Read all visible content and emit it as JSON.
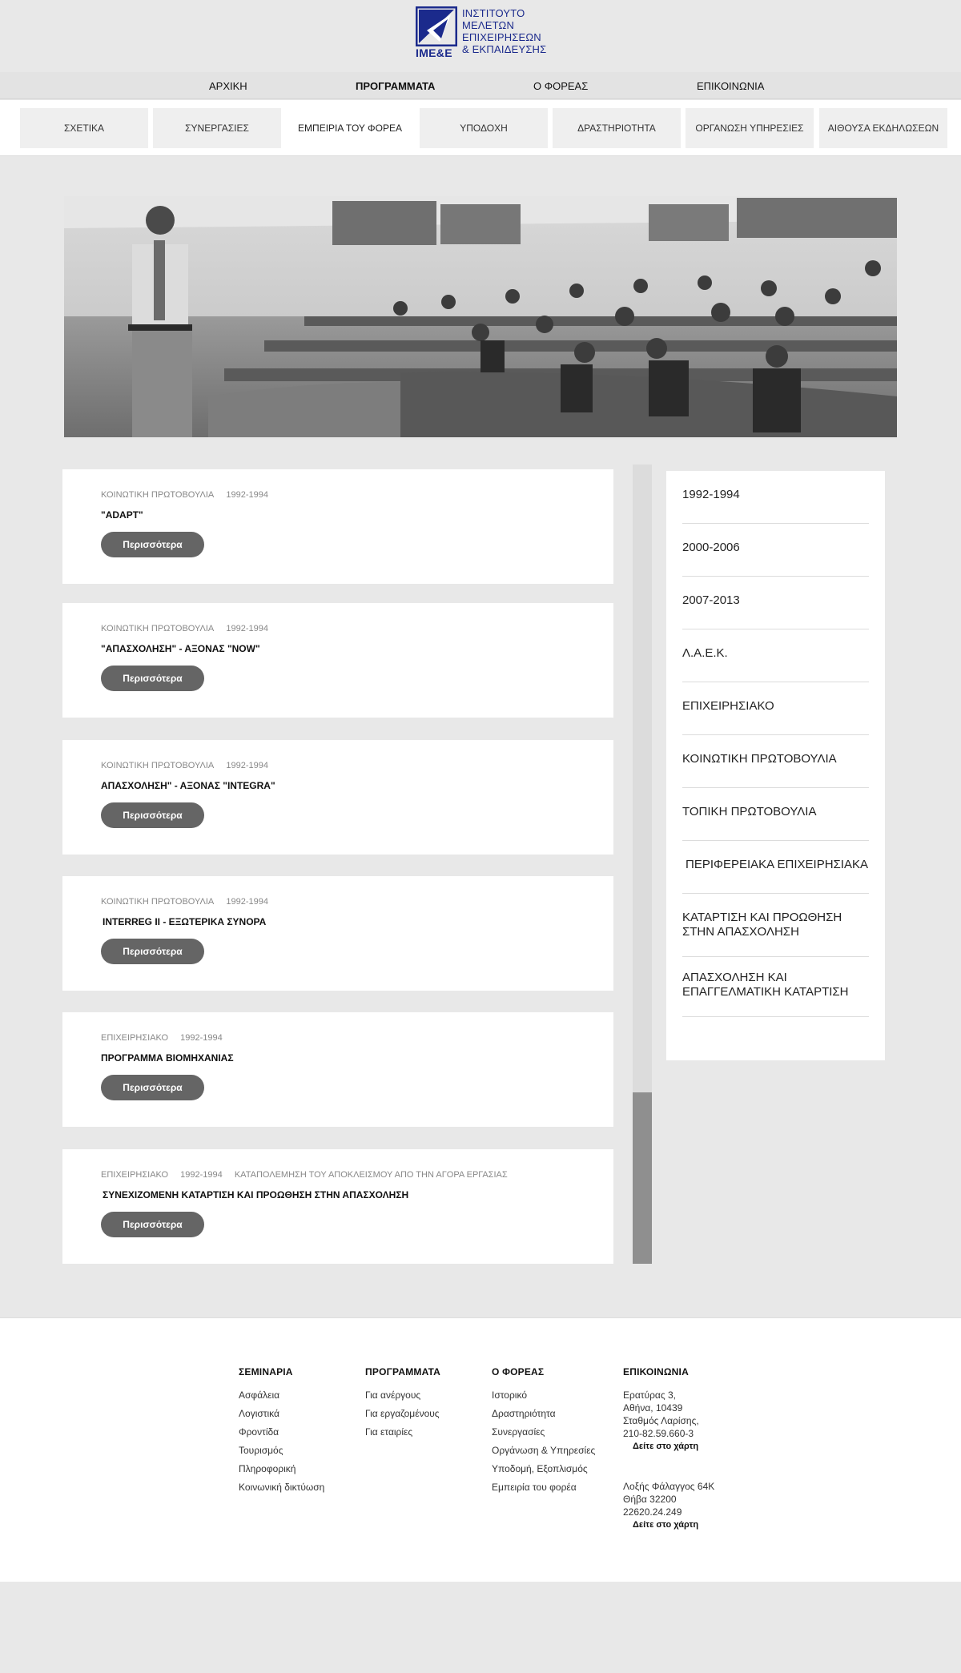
{
  "brand": {
    "lines": [
      "ΙΝΣΤΙΤΟΥΤΟ",
      "ΜΕΛΕΤΩΝ",
      "ΕΠΙΧΕΙΡΗΣΕΩΝ",
      "& ΕΚΠΑΙΔΕΥΣΗΣ"
    ],
    "abbr": "IME&E",
    "color": "#1b2a8c"
  },
  "main_nav": [
    "ΑΡΧΙΚΗ",
    "ΠΡΟΓΡΑΜΜΑΤΑ",
    "Ο ΦΟΡΕΑΣ",
    "ΕΠΙΚΟΙΝΩΝΙΑ"
  ],
  "main_nav_active": "ΠΡΟΓΡΑΜΜΑΤΑ",
  "sub_nav": [
    "ΣΧΕΤΙΚΑ",
    "ΣΥΝΕΡΓΑΣΙΕΣ",
    "ΕΜΠΕΙΡΙΑ ΤΟΥ ΦΟΡΕΑ",
    "ΥΠΟΔΟΧΗ",
    "ΔΡΑΣΤΗΡΙΟΤΗΤΑ",
    "ΟΡΓΑΝΩΣΗ ΥΠΗΡΕΣΙΕΣ",
    "ΑΙΘΟΥΣΑ ΕΚΔΗΛΩΣΕΩΝ"
  ],
  "sub_nav_active": "ΕΜΠΕΙΡΙΑ ΤΟΥ ΦΟΡΕΑ",
  "programs": [
    {
      "meta": [
        "ΚΟΙΝΩΤΙΚΗ ΠΡΩΤΟΒΟΥΛΙΑ",
        "1992-1994"
      ],
      "title": "\"ADAPT\"",
      "button": "Περισσότερα"
    },
    {
      "meta": [
        "ΚΟΙΝΩΤΙΚΗ ΠΡΩΤΟΒΟΥΛΙΑ",
        "1992-1994"
      ],
      "title": "\"ΑΠΑΣΧΟΛΗΣΗ\" - ΑΞΟΝΑΣ \"NOW\"",
      "button": "Περισσότερα"
    },
    {
      "meta": [
        "ΚΟΙΝΩΤΙΚΗ ΠΡΩΤΟΒΟΥΛΙΑ",
        "1992-1994"
      ],
      "title": "ΑΠΑΣΧΟΛΗΣΗ\" - ΑΞΟΝΑΣ \"INTEGRA\"",
      "button": "Περισσότερα"
    },
    {
      "meta": [
        "ΚΟΙΝΩΤΙΚΗ ΠΡΩΤΟΒΟΥΛΙΑ",
        "1992-1994"
      ],
      "title": "INTERREG II - ΕΞΩΤΕΡΙΚΑ ΣΥΝΟΡΑ",
      "button": "Περισσότερα"
    },
    {
      "meta": [
        "ΕΠΙΧΕΙΡΗΣΙΑΚΟ",
        "1992-1994"
      ],
      "title": "ΠΡΟΓΡΑΜΜΑ ΒΙΟΜΗΧΑΝΙΑΣ",
      "button": "Περισσότερα"
    },
    {
      "meta": [
        "ΕΠΙΧΕΙΡΗΣΙΑΚΟ",
        "1992-1994",
        "ΚΑΤΑΠΟΛΕΜΗΣΗ ΤΟΥ ΑΠΟΚΛΕΙΣΜΟΥ ΑΠΟ ΤΗΝ ΑΓΟΡΑ ΕΡΓΑΣΙΑΣ"
      ],
      "title": "ΣΥΝΕΧΙΖΟΜΕΝΗ ΚΑΤΑΡΤΙΣΗ ΚΑΙ ΠΡΟΩΘΗΣΗ ΣΤΗΝ ΑΠΑΣΧΟΛΗΣΗ",
      "button": "Περισσότερα"
    }
  ],
  "scroll": {
    "position": 0.79
  },
  "filters": [
    "1992-1994",
    "2000-2006",
    "2007-2013",
    "Λ.Α.Ε.Κ.",
    "ΕΠΙΧΕΙΡΗΣΙΑΚΟ",
    "ΚΟΙΝΩΤΙΚΗ ΠΡΩΤΟΒΟΥΛΙΑ",
    "ΤΟΠΙΚΗ ΠΡΩΤΟΒΟΥΛΙΑ",
    " ΠΕΡΙΦΕΡΕΙΑΚΑ ΕΠΙΧΕΙΡΗΣΙΑΚΑ",
    "ΚΑΤΑΡΤΙΣΗ ΚΑΙ ΠΡΟΩΘΗΣΗ ΣΤΗΝ ΑΠΑΣΧΟΛΗΣΗ",
    "ΑΠΑΣΧΟΛΗΣΗ ΚΑΙ ΕΠΑΓΓΕΛΜΑΤΙΚΗ ΚΑΤΑΡΤΙΣΗ"
  ],
  "footer": {
    "seminars": {
      "heading": "ΣΕΜΙΝΑΡΙΑ",
      "links": [
        "Ασφάλεια",
        "Λογιστικά",
        "Φροντίδα",
        "Τουρισμός",
        "Πληροφορική",
        "Κοινωνική δικτύωση"
      ]
    },
    "programs": {
      "heading": "ΠΡΟΓΡΑΜΜΑΤΑ",
      "links": [
        "Για ανέργους",
        "Για εργαζομένους",
        "Για εταιρίες"
      ]
    },
    "organization": {
      "heading": "Ο ΦΟΡΕΑΣ",
      "links": [
        "Ιστορικό",
        "Δραστηριότητα",
        "Συνεργασίες",
        "Οργάνωση & Υπηρεσίες",
        "Υποδομή, Εξοπλισμός",
        "Εμπειρία του φορέα"
      ]
    },
    "contact": {
      "heading": "ΕΠΙΚΟΙΝΩΝΙΑ",
      "address1": [
        "Ερατύρας 3,",
        "Αθήνα, 10439",
        "Σταθμός Λαρίσης,",
        "210-82.59.660-3"
      ],
      "address2": [
        "Λοξής Φάλαγγος 64Κ",
        "Θήβα 32200",
        "22620.24.249"
      ],
      "map_link": "Δείτε στο χάρτη"
    }
  }
}
